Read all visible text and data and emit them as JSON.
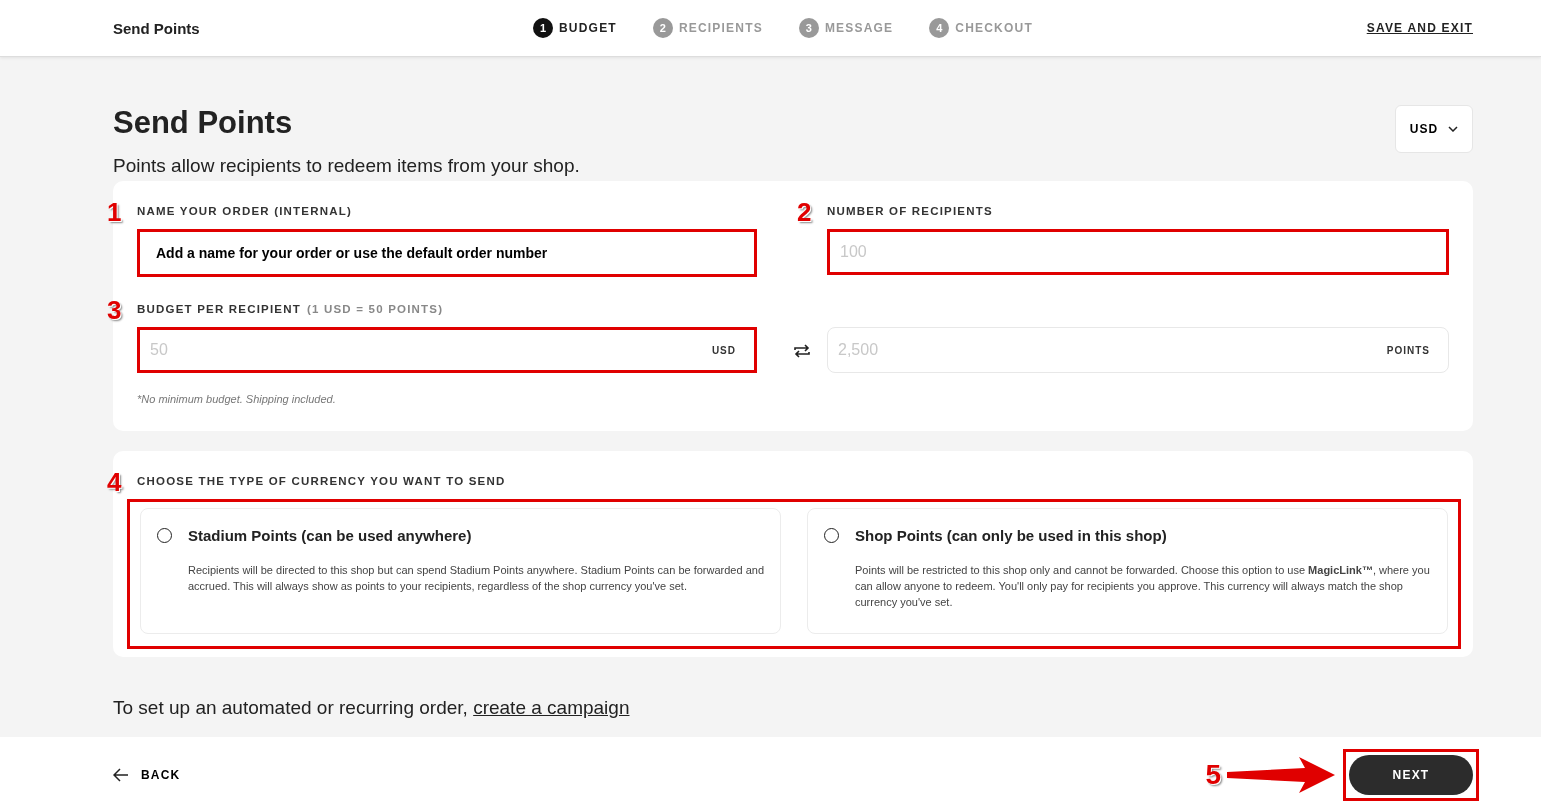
{
  "header": {
    "title": "Send Points",
    "save_exit": "SAVE AND EXIT"
  },
  "steps": [
    {
      "number": "1",
      "label": "BUDGET",
      "selected": true
    },
    {
      "number": "2",
      "label": "RECIPIENTS",
      "selected": false
    },
    {
      "number": "3",
      "label": "MESSAGE",
      "selected": false
    },
    {
      "number": "4",
      "label": "CHECKOUT",
      "selected": false
    }
  ],
  "page": {
    "title": "Send Points",
    "subtitle": "Points allow recipients to redeem items from your shop.",
    "currency_select": "USD"
  },
  "order_name": {
    "callout": "1",
    "label": "NAME YOUR ORDER (INTERNAL)",
    "placeholder": "Add a name for your order or use the default order number"
  },
  "recipients": {
    "callout": "2",
    "label": "NUMBER OF RECIPIENTS",
    "placeholder": "100"
  },
  "budget": {
    "callout": "3",
    "label": "BUDGET PER RECIPIENT",
    "rate": "(1 USD = 50 POINTS)",
    "placeholder": "50",
    "unit": "USD",
    "points_placeholder": "2,500",
    "points_unit": "POINTS",
    "note": "*No minimum budget. Shipping included."
  },
  "currency_type": {
    "callout": "4",
    "label": "CHOOSE THE TYPE OF CURRENCY YOU WANT TO SEND",
    "options": [
      {
        "title": "Stadium Points (can be used anywhere)",
        "description": "Recipients will be directed to this shop but can spend Stadium Points anywhere. Stadium Points can be forwarded and accrued. This will always show as points to your recipients, regardless of the shop currency you've set.",
        "selected": false
      },
      {
        "title": "Shop Points (can only be used in this shop)",
        "description": "Points will be restricted to this shop only and cannot be forwarded. Choose this option to use **MagicLink™**, where you can allow anyone to redeem. You'll only pay for recipients you approve. This currency will always match the shop currency you've set.",
        "selected": false
      }
    ]
  },
  "campaign": {
    "text": "To set up an automated or recurring order,",
    "link": "create a campaign"
  },
  "footer": {
    "back": "BACK",
    "next": "NEXT",
    "callout": "5"
  }
}
